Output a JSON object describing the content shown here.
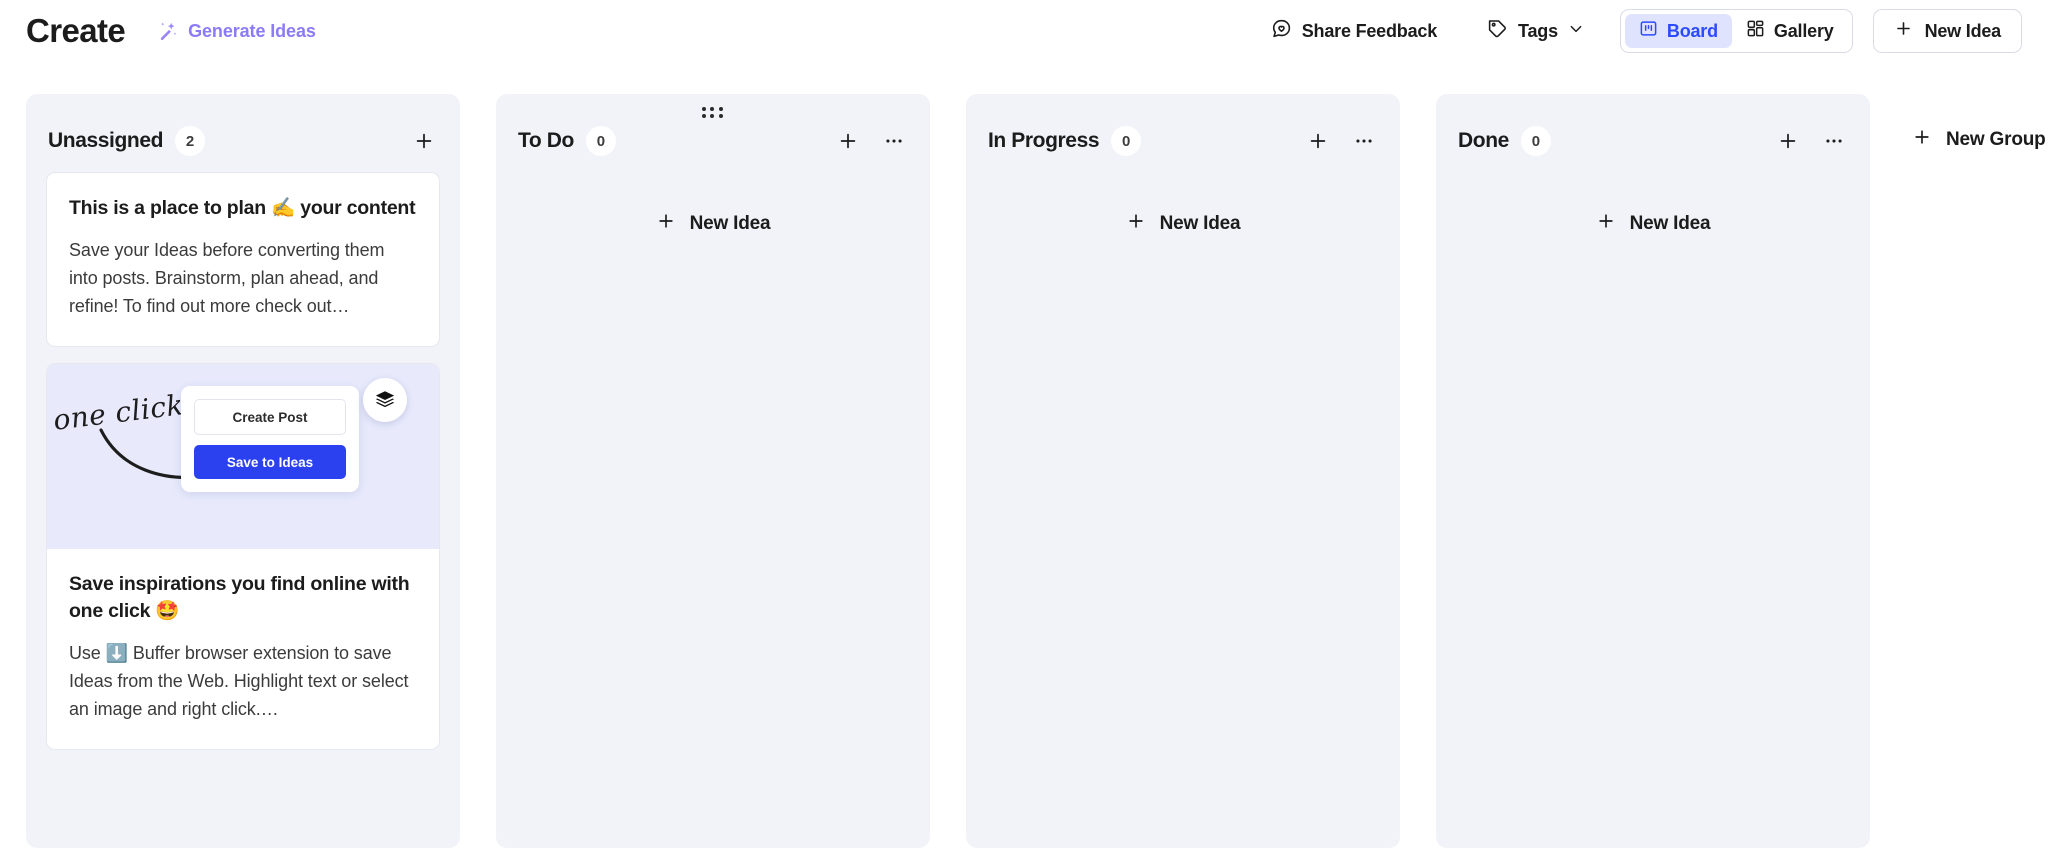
{
  "header": {
    "title": "Create",
    "generate_ideas": {
      "label": "Generate Ideas",
      "icon": "magic-wand-icon",
      "color": "#8b7bf7"
    },
    "share_feedback": {
      "label": "Share Feedback",
      "icon": "chat-heart-icon"
    },
    "tags": {
      "label": "Tags",
      "icon": "tag-icon",
      "chevron": "chevron-down-icon"
    },
    "view_toggle": {
      "options": [
        {
          "label": "Board",
          "icon": "board-icon",
          "active": true
        },
        {
          "label": "Gallery",
          "icon": "gallery-grid-icon",
          "active": false
        }
      ],
      "active_color": "#2c4bff",
      "active_bg": "#dfe3fd"
    },
    "new_idea": {
      "label": "New Idea",
      "icon": "plus-icon"
    }
  },
  "board": {
    "new_group": {
      "label": "New Group",
      "icon": "plus-icon"
    },
    "columns": [
      {
        "title": "Unassigned",
        "count": "2",
        "has_drag_handle": false,
        "has_more_menu": false,
        "add_icon": "plus-icon",
        "empty_label": "",
        "cards": [
          {
            "title": "This is a place to plan ✍️ your content",
            "text": "Save your Ideas before converting them into posts. Brainstorm, plan ahead, and refine! To find out more check out…",
            "has_media": false
          },
          {
            "title": "Save inspirations you find online with one click 🤩",
            "text": "Use ⬇️ Buffer browser extension to save Ideas from the Web. Highlight text or select an image and right click.…",
            "has_media": true,
            "media": {
              "script_text": "one click",
              "mock_input_label": "Create Post",
              "mock_cta_label": "Save to Ideas",
              "badge_icon": "layers-icon",
              "bg": "#e8eafc",
              "cta_color": "#2b41f0"
            }
          }
        ]
      },
      {
        "title": "To Do",
        "count": "0",
        "has_drag_handle": true,
        "has_more_menu": true,
        "add_icon": "plus-icon",
        "empty_label": "New Idea",
        "cards": []
      },
      {
        "title": "In Progress",
        "count": "0",
        "has_drag_handle": false,
        "has_more_menu": true,
        "add_icon": "plus-icon",
        "empty_label": "New Idea",
        "cards": []
      },
      {
        "title": "Done",
        "count": "0",
        "has_drag_handle": false,
        "has_more_menu": true,
        "add_icon": "plus-icon",
        "empty_label": "New Idea",
        "cards": []
      }
    ]
  }
}
